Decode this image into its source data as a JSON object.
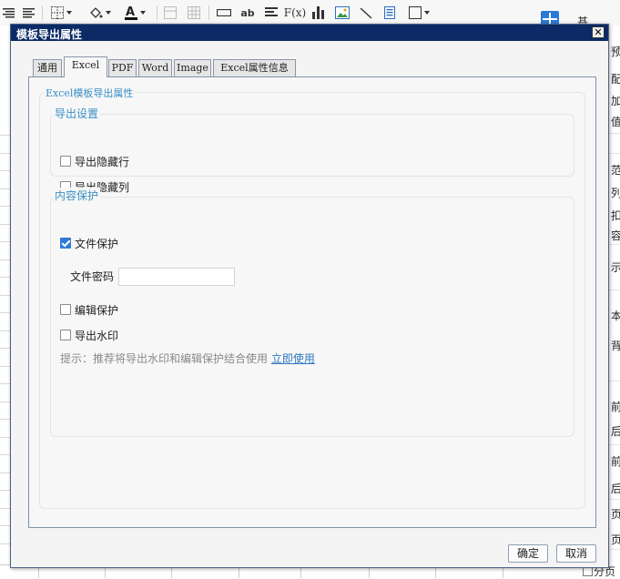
{
  "background": {
    "right_panel_fragments": [
      "预",
      "配",
      "加",
      "值",
      "范",
      "列",
      "扣",
      "容",
      "示",
      "本",
      "背",
      "前",
      "后",
      "前",
      "后",
      "页",
      "页"
    ],
    "top_right_text": "基",
    "bottom_checkbox_label": "分页"
  },
  "dialog": {
    "title": "模板导出属性",
    "close_symbol": "✕",
    "tabs": [
      {
        "label": "通用"
      },
      {
        "label": "Excel"
      },
      {
        "label": "PDF"
      },
      {
        "label": "Word"
      },
      {
        "label": "Image"
      },
      {
        "label": "Excel属性信息"
      }
    ],
    "active_tab": "Excel",
    "outer_group_title": "Excel模板导出属性",
    "export_settings": {
      "title": "导出设置",
      "items": [
        {
          "label": "导出隐藏行",
          "checked": false
        },
        {
          "label": "导出隐藏列",
          "checked": false
        }
      ]
    },
    "content_protection": {
      "title": "内容保护",
      "file_protect": {
        "label": "文件保护",
        "checked": true
      },
      "password_label": "文件密码",
      "password_value": "",
      "edit_protect": {
        "label": "编辑保护",
        "checked": false
      },
      "watermark": {
        "label": "导出水印",
        "checked": false
      },
      "hint": "提示：推荐将导出水印和编辑保护结合使用",
      "hint_link": "立即使用"
    },
    "ok_label": "确定",
    "cancel_label": "取消"
  }
}
